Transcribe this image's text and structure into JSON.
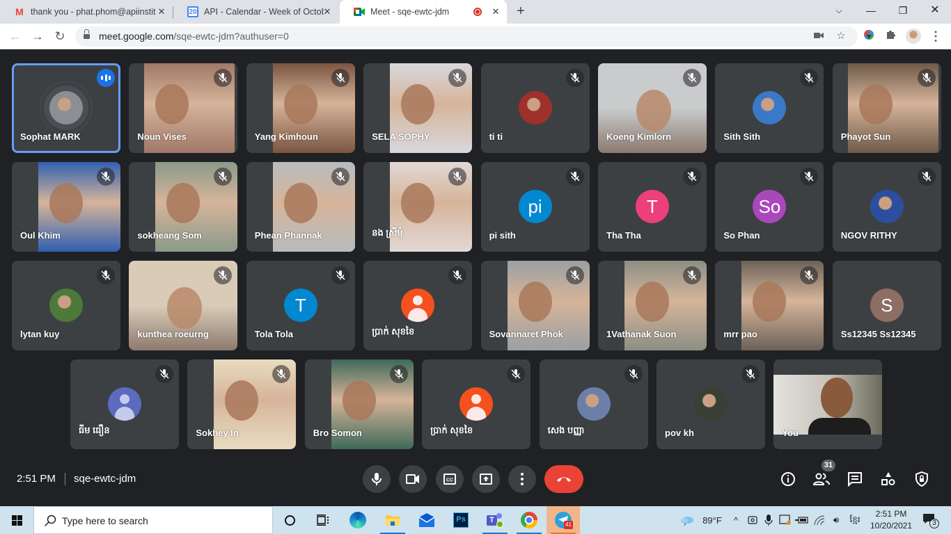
{
  "browser": {
    "tabs": [
      {
        "title": "thank you - phat.phom@apiinstit",
        "favicon": "gmail-icon",
        "active": false
      },
      {
        "title": "API - Calendar - Week of Octobe",
        "favicon": "calendar-icon",
        "favicon_text": "20",
        "active": false
      },
      {
        "title": "Meet - sqe-ewtc-jdm",
        "favicon": "meet-icon",
        "active": true,
        "recording": true
      }
    ],
    "url_host": "meet.google.com",
    "url_path": "/sqe-ewtc-jdm?authuser=0"
  },
  "meeting": {
    "time": "2:51 PM",
    "code": "sqe-ewtc-jdm",
    "participant_count": "31"
  },
  "participants": [
    {
      "name": "Sophat MARK",
      "type": "photo-avatar",
      "speaking": true,
      "muted": false,
      "bg": "#8b8f93"
    },
    {
      "name": "Noun Vises",
      "type": "video",
      "muted": true,
      "bg": "#a07868"
    },
    {
      "name": "Yang Kimhoun",
      "type": "video",
      "muted": true,
      "bg": "#7a5540"
    },
    {
      "name": "SELA SOPHY",
      "type": "video",
      "muted": true,
      "bg": "#d8d8dc"
    },
    {
      "name": "ti ti",
      "type": "photo-avatar",
      "muted": true,
      "bg": "#a0302c"
    },
    {
      "name": "Koeng Kimlorn",
      "type": "video-full",
      "muted": true,
      "bg": "#c9cbcc"
    },
    {
      "name": "Sith Sith",
      "type": "photo-avatar",
      "muted": true,
      "bg": "#3a78c8"
    },
    {
      "name": "Phayot Sun",
      "type": "video",
      "muted": true,
      "bg": "#6e5a48"
    },
    {
      "name": "Oul Khim",
      "type": "video",
      "muted": true,
      "bg": "#3160b0"
    },
    {
      "name": "sokheang Som",
      "type": "video",
      "muted": true,
      "bg": "#8a9a8a"
    },
    {
      "name": "Phean Phannak",
      "type": "video",
      "muted": true,
      "bg": "#b8bcbe"
    },
    {
      "name": "នង ស្រីមុំ",
      "type": "video",
      "muted": true,
      "bg": "#e2d8d6"
    },
    {
      "name": "pi sith",
      "type": "initials",
      "initials": "pi",
      "muted": true,
      "bg": "#0288d1"
    },
    {
      "name": "Tha Tha",
      "type": "initials",
      "initials": "T",
      "muted": true,
      "bg": "#ec407a"
    },
    {
      "name": "So Phan",
      "type": "initials",
      "initials": "So",
      "muted": true,
      "bg": "#ab47bc"
    },
    {
      "name": "NGOV RITHY",
      "type": "photo-avatar",
      "muted": true,
      "bg": "#2b4f9e"
    },
    {
      "name": "lytan kuy",
      "type": "photo-avatar",
      "muted": true,
      "bg": "#4d7a3a"
    },
    {
      "name": "kunthea roeurng",
      "type": "video-full",
      "muted": true,
      "bg": "#d9cbb8"
    },
    {
      "name": "Tola Tola",
      "type": "initials",
      "initials": "T",
      "muted": true,
      "bg": "#0288d1"
    },
    {
      "name": "ប្រាក់ សុខខៃ",
      "type": "generic",
      "muted": true,
      "bg": "#f4511e"
    },
    {
      "name": "Sovannaret Phok",
      "type": "video",
      "muted": true,
      "bg": "#9aa0a2"
    },
    {
      "name": "1Vathanak Suon",
      "type": "video",
      "muted": true,
      "bg": "#8c8f84"
    },
    {
      "name": "mrr pao",
      "type": "video",
      "muted": true,
      "bg": "#6c6258"
    },
    {
      "name": "Ss12345 Ss12345",
      "type": "initials",
      "initials": "S",
      "muted": false,
      "bg": "#8d6e63"
    },
    {
      "name": "ធីម ធឿន",
      "type": "generic-blue",
      "muted": true,
      "bg": "#5c6bc0"
    },
    {
      "name": "Sokhey In",
      "type": "video",
      "muted": true,
      "bg": "#e8dcc0"
    },
    {
      "name": "Bro Somon",
      "type": "video",
      "muted": true,
      "bg": "#3e6a58"
    },
    {
      "name": "ប្រាក់ សុខខៃ",
      "type": "generic",
      "muted": true,
      "bg": "#f4511e"
    },
    {
      "name": "សេង បញ្ញា",
      "type": "photo-avatar",
      "muted": true,
      "bg": "#6b7fa8"
    },
    {
      "name": "pov kh",
      "type": "photo-avatar",
      "muted": true,
      "bg": "#3a3f36"
    },
    {
      "name": "You",
      "type": "self-video",
      "muted": false,
      "bg": "#8a8680"
    }
  ],
  "controls": {
    "center": [
      "microphone-button",
      "camera-button",
      "captions-button",
      "present-button",
      "more-options-button",
      "leave-call-button"
    ],
    "right": [
      "meeting-details-button",
      "people-button",
      "chat-button",
      "activities-button",
      "host-controls-button"
    ]
  },
  "taskbar": {
    "search_placeholder": "Type here to search",
    "apps": [
      "cortana",
      "task-view",
      "edge",
      "file-explorer",
      "mail",
      "photoshop",
      "teams",
      "chrome",
      "telegram"
    ],
    "telegram_badge": "41",
    "weather": "89°F",
    "time": "2:51 PM",
    "date": "10/20/2021",
    "notifications": "3"
  }
}
